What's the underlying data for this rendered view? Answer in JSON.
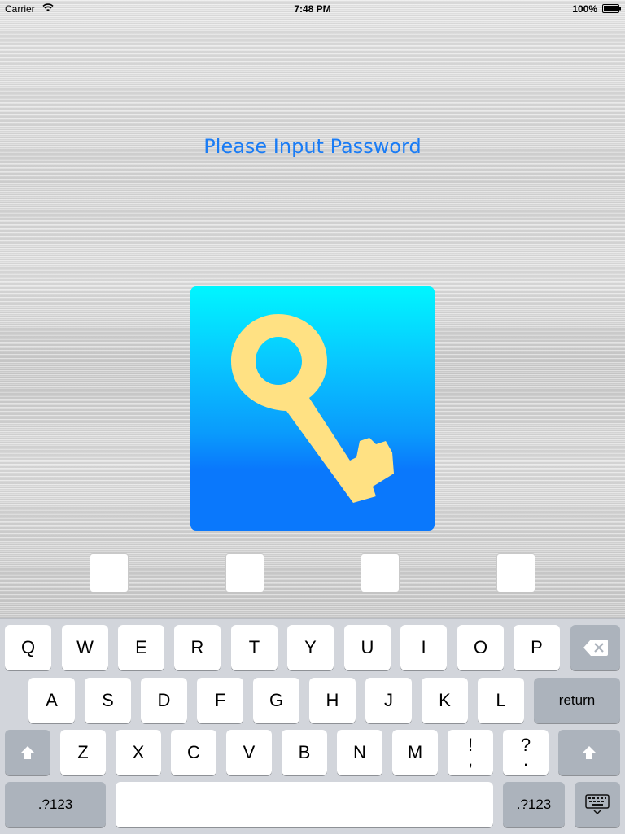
{
  "status_bar": {
    "carrier": "Carrier",
    "time": "7:48 PM",
    "battery": "100%"
  },
  "prompt": "Please Input Password",
  "colors": {
    "accent": "#1a7cf5",
    "tile_top": "#00f6ff",
    "tile_bottom": "#0a78fc",
    "key_color": "#ffe183"
  },
  "pin_slots": 4,
  "keyboard": {
    "row1": [
      "Q",
      "W",
      "E",
      "R",
      "T",
      "Y",
      "U",
      "I",
      "O",
      "P"
    ],
    "row2": [
      "A",
      "S",
      "D",
      "F",
      "G",
      "H",
      "J",
      "K",
      "L"
    ],
    "row3": [
      "Z",
      "X",
      "C",
      "V",
      "B",
      "N",
      "M"
    ],
    "punct1": {
      "top": "!",
      "bottom": ","
    },
    "punct2": {
      "top": "?",
      "bottom": "."
    },
    "return_label": "return",
    "numbers_label": ".?123",
    "icons": {
      "backspace": "backspace-icon",
      "shift": "shift-icon",
      "hide_keyboard": "keyboard-hide-icon"
    }
  }
}
